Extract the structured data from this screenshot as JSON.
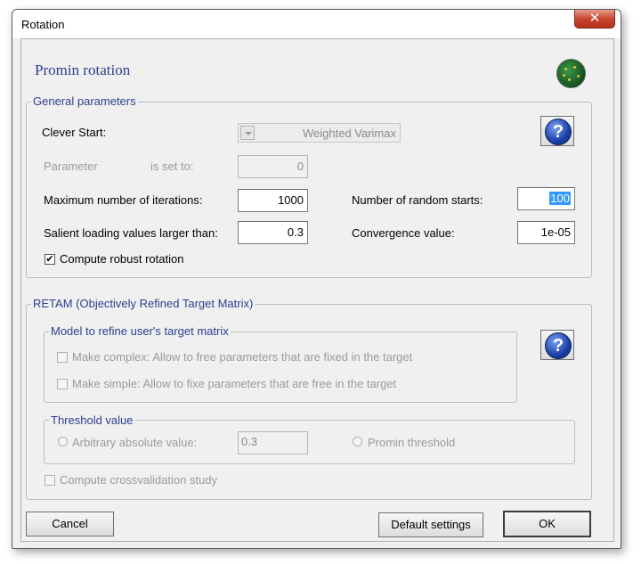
{
  "window": {
    "title": "Rotation",
    "close_glyph": "✕"
  },
  "heading": "Promin rotation",
  "globe_icon": "globe-icon",
  "general": {
    "legend": "General parameters",
    "clever_start_label": "Clever Start:",
    "clever_start_value": "Weighted Varimax",
    "parameter_label": "Parameter",
    "is_set_to_label": "is set to:",
    "parameter_value": "0",
    "max_iter_label": "Maximum number of iterations:",
    "max_iter_value": "1000",
    "random_starts_label": "Number of random starts:",
    "random_starts_value": "100",
    "salient_label": "Salient loading values larger than:",
    "salient_value": "0.3",
    "convergence_label": "Convergence value:",
    "convergence_value": "1e-05",
    "robust_label": "Compute robust rotation",
    "robust_checked": "✔"
  },
  "retam": {
    "legend": "RETAM (Objectively Refined Target Matrix)",
    "model_legend": "Model to refine user's target matrix",
    "make_complex_label": "Make complex: Allow to free parameters that are fixed in the target",
    "make_simple_label": "Make simple: Allow to fixe parameters that are free in the target",
    "threshold_legend": "Threshold value",
    "arbitrary_label": "Arbitrary absolute value:",
    "arbitrary_value": "0.3",
    "promin_threshold_label": "Promin threshold",
    "crossval_label": "Compute crossvalidation study"
  },
  "help_glyph": "?",
  "buttons": {
    "cancel": "Cancel",
    "default_settings": "Default settings",
    "ok": "OK"
  }
}
